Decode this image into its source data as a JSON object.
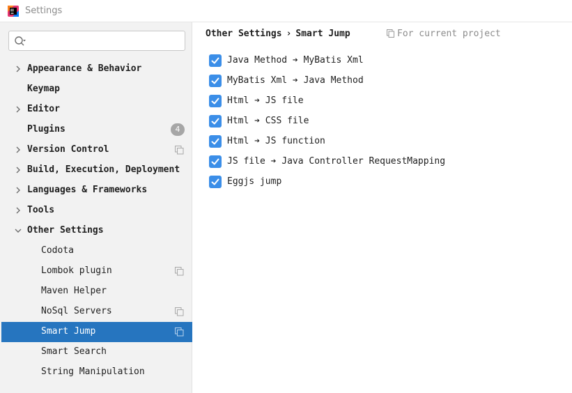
{
  "window": {
    "title": "Settings"
  },
  "search": {
    "value": "",
    "placeholder": ""
  },
  "sidebar": {
    "items": [
      {
        "label": "Appearance & Behavior",
        "bold": true,
        "expandable": true
      },
      {
        "label": "Keymap",
        "bold": true,
        "expandable": false
      },
      {
        "label": "Editor",
        "bold": true,
        "expandable": true
      },
      {
        "label": "Plugins",
        "bold": true,
        "expandable": false,
        "badge": "4"
      },
      {
        "label": "Version Control",
        "bold": true,
        "expandable": true,
        "project_scope": true
      },
      {
        "label": "Build, Execution, Deployment",
        "bold": true,
        "expandable": true
      },
      {
        "label": "Languages & Frameworks",
        "bold": true,
        "expandable": true
      },
      {
        "label": "Tools",
        "bold": true,
        "expandable": true
      },
      {
        "label": "Other Settings",
        "bold": true,
        "expandable": true,
        "expanded": true
      },
      {
        "label": "Codota",
        "bold": false
      },
      {
        "label": "Lombok plugin",
        "bold": false,
        "project_scope": true
      },
      {
        "label": "Maven Helper",
        "bold": false
      },
      {
        "label": "NoSql Servers",
        "bold": false,
        "project_scope": true
      },
      {
        "label": "Smart Jump",
        "bold": false,
        "project_scope": true,
        "selected": true
      },
      {
        "label": "Smart Search",
        "bold": false
      },
      {
        "label": "String Manipulation",
        "bold": false
      }
    ]
  },
  "breadcrumb": {
    "parent": "Other Settings",
    "separator": "›",
    "current": "Smart Jump"
  },
  "scope_hint": {
    "label": "For current project"
  },
  "options": [
    {
      "label": "Java Method ➔ MyBatis Xml",
      "checked": true
    },
    {
      "label": "MyBatis Xml ➔ Java Method",
      "checked": true
    },
    {
      "label": "Html ➔ JS file",
      "checked": true
    },
    {
      "label": "Html ➔ CSS file",
      "checked": true
    },
    {
      "label": "Html ➔ JS function",
      "checked": true
    },
    {
      "label": "JS file ➔ Java Controller RequestMapping",
      "checked": true
    },
    {
      "label": "Eggjs jump",
      "checked": true
    }
  ],
  "colors": {
    "accent": "#2675bf",
    "checkbox": "#3b8ee8",
    "sidebar_bg": "#f2f2f2",
    "badge": "#a6a6a6"
  }
}
